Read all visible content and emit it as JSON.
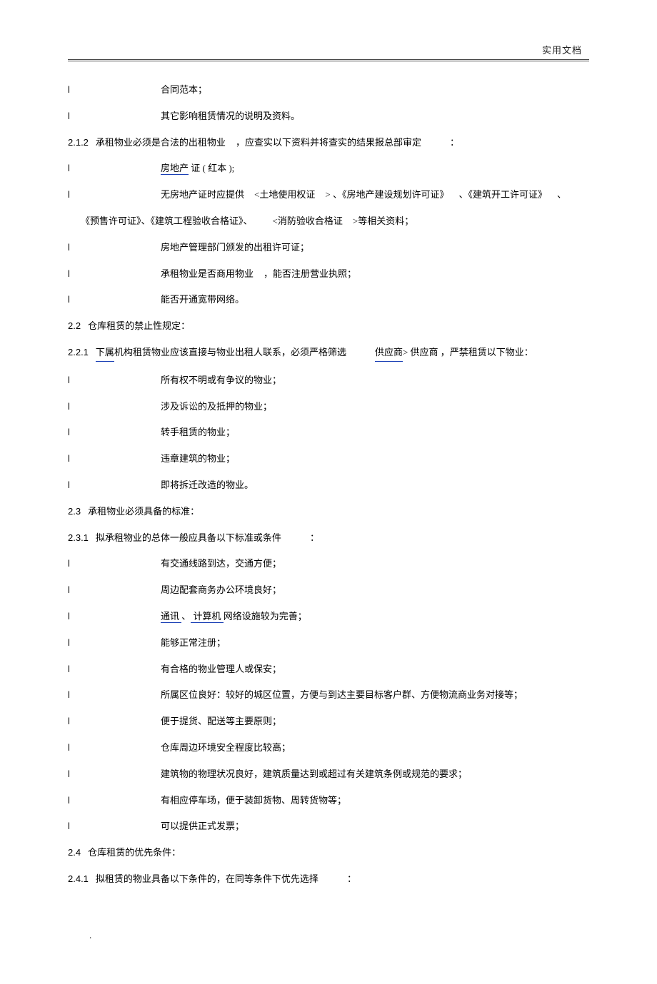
{
  "header": {
    "text": "实用文档"
  },
  "lines": {
    "b1": "合同范本；",
    "b2": "其它影响租赁情况的说明及资料。",
    "s212_pre": "承租物业必须是合法的出租物业",
    "s212_mid": "，应查实以下资料并将查实的结果报总部审定",
    "s212_colon": "：",
    "b3_link": "房地产",
    "b3_rest": " 证 ( 红本 );",
    "b4_a": "无房地产证时应提供",
    "b4_b": "<土地使用权证",
    "b4_c": "> 、《房地产建设规划许可证》",
    "b4_d": "、《建筑开工许可证》",
    "b4_e": "、",
    "b4_cont": "《预售许可证》、《建筑工程验收合格证》、",
    "b4_f": "<消防验收合格证",
    "b4_g": ">等相关资料；",
    "b5": "房地产管理部门颁发的出租许可证；",
    "b6_a": "承租物业是否商用物业",
    "b6_b": "，能否注册营业执照；",
    "b7": "能否开通宽带网络。",
    "s22": "仓库租赁的禁止性规定：",
    "s221_link": "下属",
    "s221_a": " 机构租赁物业应该直接与物业出租人联系，必须严格筛选",
    "s221_link2": "供应商",
    "s221_b": " > 供应商 ，严禁租赁以下物业：",
    "b8": "所有权不明或有争议的物业；",
    "b9": "涉及诉讼的及抵押的物业；",
    "b10": "转手租赁的物业；",
    "b11": "违章建筑的物业；",
    "b12": "即将拆迁改造的物业。",
    "s23": "承租物业必须具备的标准：",
    "s231_a": "拟承租物业的总体一般应具备以下标准或条件",
    "s231_b": "：",
    "b13": "有交通线路到达，交通方便；",
    "b14": "周边配套商务办公环境良好；",
    "b15_link1": " 通讯 ",
    "b15_mid": "、",
    "b15_link2": " 计算机 ",
    "b15_rest": "网络设施较为完善；",
    "b16": "能够正常注册；",
    "b17": "有合格的物业管理人或保安；",
    "b18": "所属区位良好：较好的城区位置，方便与到达主要目标客户群、方便物流商业务对接等；",
    "b19": "便于提货、配送等主要原则；",
    "b20": "仓库周边环境安全程度比较高；",
    "b21": "建筑物的物理状况良好，建筑质量达到或超过有关建筑条例或规范的要求；",
    "b22": "有相应停车场，便于装卸货物、周转货物等；",
    "b23": "可以提供正式发票；",
    "s24": "仓库租赁的优先条件：",
    "s241_a": "拟租赁的物业具备以下条件的，在同等条件下优先选择",
    "s241_b": "："
  },
  "nums": {
    "n212": "2.1.2",
    "n22": "2.2",
    "n221": "2.2.1",
    "n23": "2.3",
    "n231": "2.3.1",
    "n24": "2.4",
    "n241": "2.4.1"
  },
  "footer": {
    "dot": "."
  }
}
